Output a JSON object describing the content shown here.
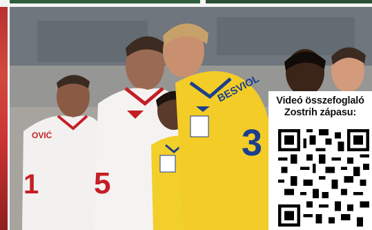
{
  "overlay": {
    "line1": "Videó összefoglaló",
    "line2": "Zostrih zápasu:"
  },
  "jersey": {
    "player_name": "BESVIOL",
    "number": "3"
  },
  "icons": {
    "qr": "qr-code-icon"
  }
}
